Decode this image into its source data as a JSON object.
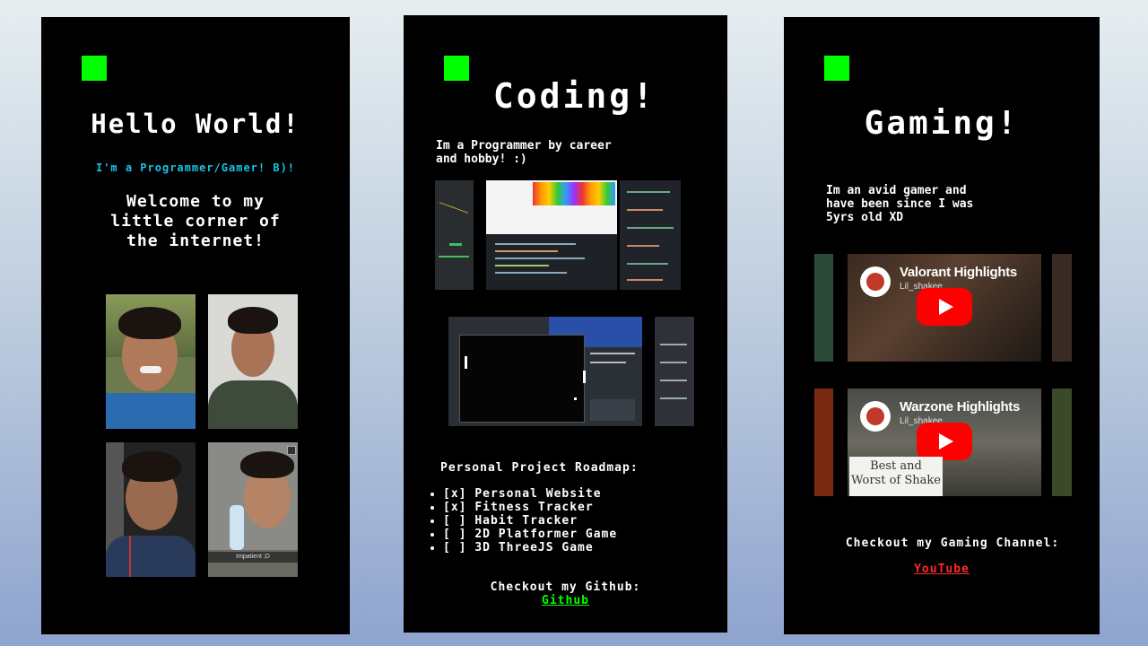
{
  "colors": {
    "accent_green": "#00ff00",
    "cyan": "#19c3e6",
    "link_red": "#ff2a2a",
    "youtube_red": "#ff0000",
    "panel_bg": "#000000"
  },
  "panel_hello": {
    "title": "Hello World!",
    "subtitle": "I'm a Programmer/Gamer! B)!",
    "welcome_lines": [
      "Welcome to my",
      "little corner of",
      "the internet!"
    ],
    "photo_caption": "Impatient ;D"
  },
  "panel_coding": {
    "title": "Coding!",
    "intro_lines": [
      "Im a Programmer by career",
      "and hobby! :)"
    ],
    "roadmap_title": "Personal Project Roadmap:",
    "roadmap_items": [
      {
        "check": "[x]",
        "label": "Personal Website"
      },
      {
        "check": "[x]",
        "label": "Fitness Tracker"
      },
      {
        "check": "[ ]",
        "label": "Habit Tracker"
      },
      {
        "check": "[ ]",
        "label": "2D Platformer Game"
      },
      {
        "check": "[ ]",
        "label": "3D ThreeJS Game"
      }
    ],
    "github_prompt": "Checkout my Github:",
    "github_link": "Github"
  },
  "panel_gaming": {
    "title": "Gaming!",
    "intro_lines": [
      "Im an avid gamer and",
      "have been since I was",
      "5yrs old XD"
    ],
    "videos": [
      {
        "title": "Valorant Highlights",
        "channel": "Lil_shakee",
        "overlay": ""
      },
      {
        "title": "Warzone Highlights",
        "channel": "Lil_shakee",
        "overlay_lines": [
          "Best and",
          "Worst of Shake"
        ]
      }
    ],
    "channel_prompt": "Checkout my Gaming Channel:",
    "youtube_link": "YouTube"
  }
}
